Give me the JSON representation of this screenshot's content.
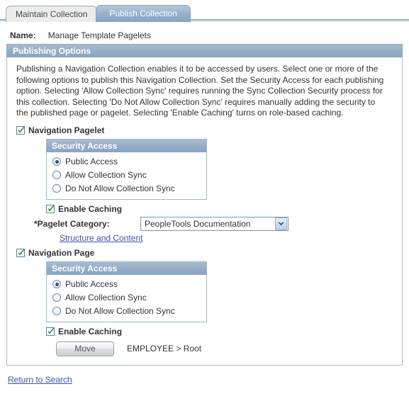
{
  "tabs": [
    {
      "label": "Maintain Collection",
      "active": false
    },
    {
      "label": "Publish Collection",
      "active": true
    }
  ],
  "name_field": {
    "label": "Name:",
    "value": "Manage Template Pagelets"
  },
  "panel": {
    "header": "Publishing Options",
    "intro": "Publishing a Navigation Collection enables it to be accessed by users. Select one or more of the following options to publish this Navigation Collection. Set the Security Access for each publishing option. Selecting 'Allow Collection Sync' requires running the Sync Collection Security process for this collection. Selecting 'Do Not Allow Collection Sync' requires manually adding the security to the published page or pagelet. Selecting 'Enable Caching' turns on role-based caching."
  },
  "pagelet_section": {
    "checkbox_label": "Navigation Pagelet",
    "checkbox_checked": true,
    "security": {
      "header": "Security Access",
      "options": [
        {
          "label": "Public Access",
          "selected": true
        },
        {
          "label": "Allow Collection Sync",
          "selected": false
        },
        {
          "label": "Do Not Allow Collection Sync",
          "selected": false
        }
      ]
    },
    "caching_label": "Enable Caching",
    "caching_checked": true,
    "category_label": "*Pagelet Category:",
    "category_value": "PeopleTools Documentation",
    "structure_link": "Structure and Content"
  },
  "page_section": {
    "checkbox_label": "Navigation Page",
    "checkbox_checked": true,
    "security": {
      "header": "Security Access",
      "options": [
        {
          "label": "Public Access",
          "selected": true
        },
        {
          "label": "Allow Collection Sync",
          "selected": false
        },
        {
          "label": "Do Not Allow Collection Sync",
          "selected": false
        }
      ]
    },
    "caching_label": "Enable Caching",
    "caching_checked": true,
    "move_button": "Move",
    "move_path": "EMPLOYEE > Root"
  },
  "footer": {
    "return_link": "Return to Search"
  },
  "colors": {
    "header_blue": "#93abc6",
    "tab_active": "#97b1cb",
    "link_blue": "#3a54b4",
    "check_green": "#1f9021",
    "radio_dot": "#2b4f80"
  },
  "icons": {
    "check": "check-icon",
    "chevron_down": "chevron-down-icon"
  }
}
